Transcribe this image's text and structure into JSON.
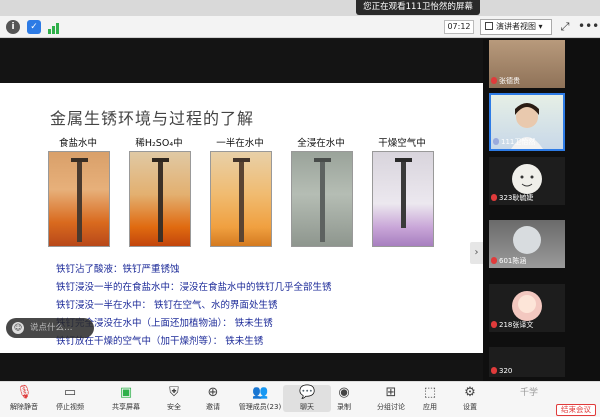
{
  "notification": {
    "text": "您正在观看111卫怡然的屏幕"
  },
  "toolbar": {
    "time": "07:12",
    "view_label": "演讲者视图",
    "more_label": "•••"
  },
  "slide": {
    "title": "金属生锈环境与过程的了解",
    "tubes": [
      {
        "label": "食盐水中"
      },
      {
        "label": "稀H₂SO₄中"
      },
      {
        "label": "一半在水中"
      },
      {
        "label": "全浸在水中"
      },
      {
        "label": "干燥空气中"
      }
    ],
    "observations": [
      "铁钉沾了酸液：铁钉严重锈蚀",
      "铁钉浸没一半的在食盐水中：浸没在食盐水中的铁钉几乎全部生锈",
      "铁钉浸没一半在水中：   铁钉在空气、水的界面处生锈",
      "铁钉完全浸没在水中（上面还加植物油）：   铁未生锈",
      "铁钉放在干燥的空气中（加干燥剂等）：   铁未生锈"
    ]
  },
  "chat_hint": "说点什么…",
  "nav_arrow": "›",
  "participants": [
    {
      "name": "张德贵",
      "mic": "muted"
    },
    {
      "name": "111卫怡然",
      "mic": "on"
    },
    {
      "name": "323耿毓婕",
      "mic": "muted"
    },
    {
      "name": "601陈涵",
      "mic": "muted"
    },
    {
      "name": "218张译文",
      "mic": "muted"
    },
    {
      "name": "320",
      "mic": "muted"
    }
  ],
  "bottom": {
    "unmute": "解除静音",
    "stop_video": "停止视频",
    "share": "共享屏幕",
    "security": "安全",
    "invite": "邀请",
    "manage": "管理成员(23)",
    "chat": "聊天",
    "record": "录制",
    "breakout": "分组讨论",
    "apps": "应用",
    "settings": "设置",
    "leave": "结束会议",
    "watermark": "千学"
  },
  "colors": {
    "accent": "#2d7be5",
    "danger": "#e03b3b",
    "slide_text": "#1d2b99",
    "highlight_border": "#2d7be5"
  }
}
